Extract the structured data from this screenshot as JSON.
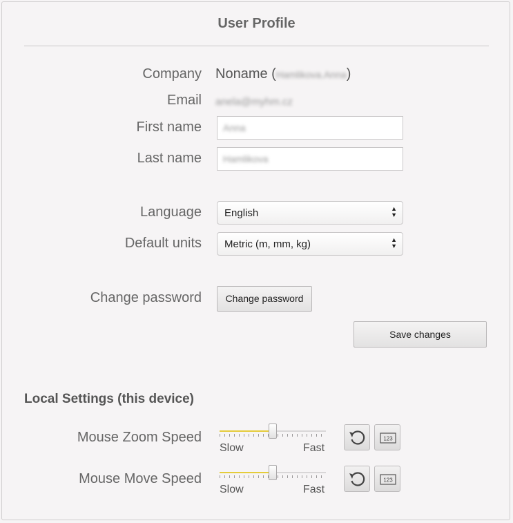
{
  "title": "User Profile",
  "profile": {
    "company_label": "Company",
    "company_value": "Noname",
    "company_open": "(",
    "company_blurred": "Hamlikova.Anna",
    "company_close": ")",
    "email_label": "Email",
    "email_value": "anela@myhm.cz",
    "first_name_label": "First name",
    "first_name_value": "Anna",
    "last_name_label": "Last name",
    "last_name_value": "Hamlikova",
    "language_label": "Language",
    "language_value": "English",
    "units_label": "Default units",
    "units_value": "Metric (m, mm, kg)",
    "password_label": "Change password",
    "password_button": "Change password",
    "save_button": "Save changes"
  },
  "local": {
    "heading": "Local Settings (this device)",
    "sliders": [
      {
        "label": "Mouse Zoom Speed",
        "min_label": "Slow",
        "max_label": "Fast",
        "value": 0.5
      },
      {
        "label": "Mouse Move Speed",
        "min_label": "Slow",
        "max_label": "Fast",
        "value": 0.5
      }
    ],
    "reset_icon": "reset-icon",
    "numeric_icon": "numeric-input-icon",
    "numeric_icon_text": "123"
  }
}
